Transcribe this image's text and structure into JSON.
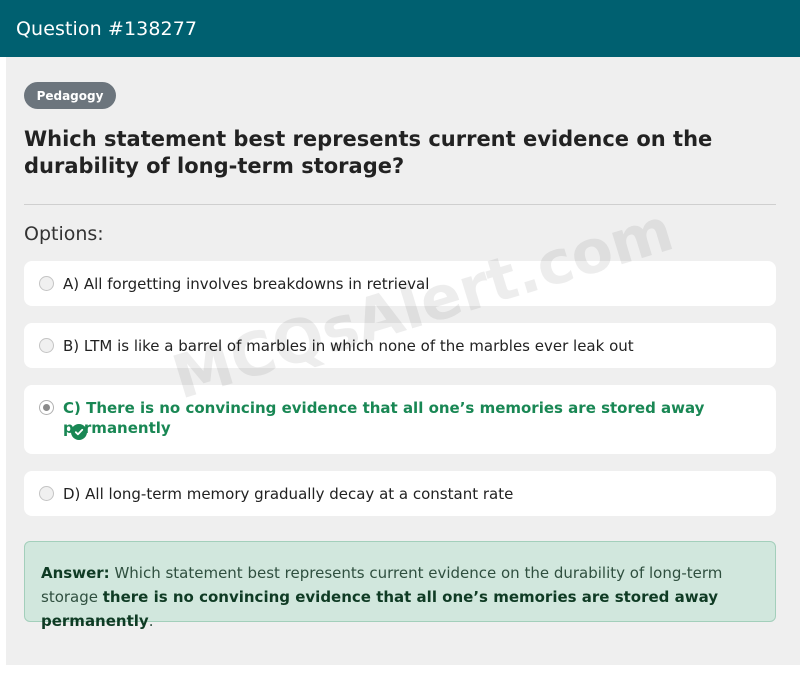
{
  "header": {
    "title": "Question #138277"
  },
  "category_badge": "Pedagogy",
  "question": "Which statement best represents current evidence on the durability of long-term storage?",
  "options_label": "Options:",
  "options": [
    {
      "label": "A) All forgetting involves breakdowns in retrieval",
      "selected": false,
      "correct": false
    },
    {
      "label": "B) LTM is like a barrel of marbles in which none of the marbles ever leak out",
      "selected": false,
      "correct": false
    },
    {
      "label": "C) There is no convincing evidence that all one’s memories are stored away permanently",
      "selected": true,
      "correct": true
    },
    {
      "label": "D) All long-term memory gradually decay at a constant rate",
      "selected": false,
      "correct": false
    }
  ],
  "answer": {
    "prefix": "Answer:",
    "question_text": "Which statement best represents current evidence on the durability of long-term storage",
    "correct_text": "there is no convincing evidence that all one’s memories are stored away permanently",
    "suffix": "."
  },
  "watermark": "MCQsAlert.com",
  "colors": {
    "header": "#006070",
    "correct": "#198754",
    "answer_bg": "#d1e7dd",
    "badge": "#6c757d"
  }
}
